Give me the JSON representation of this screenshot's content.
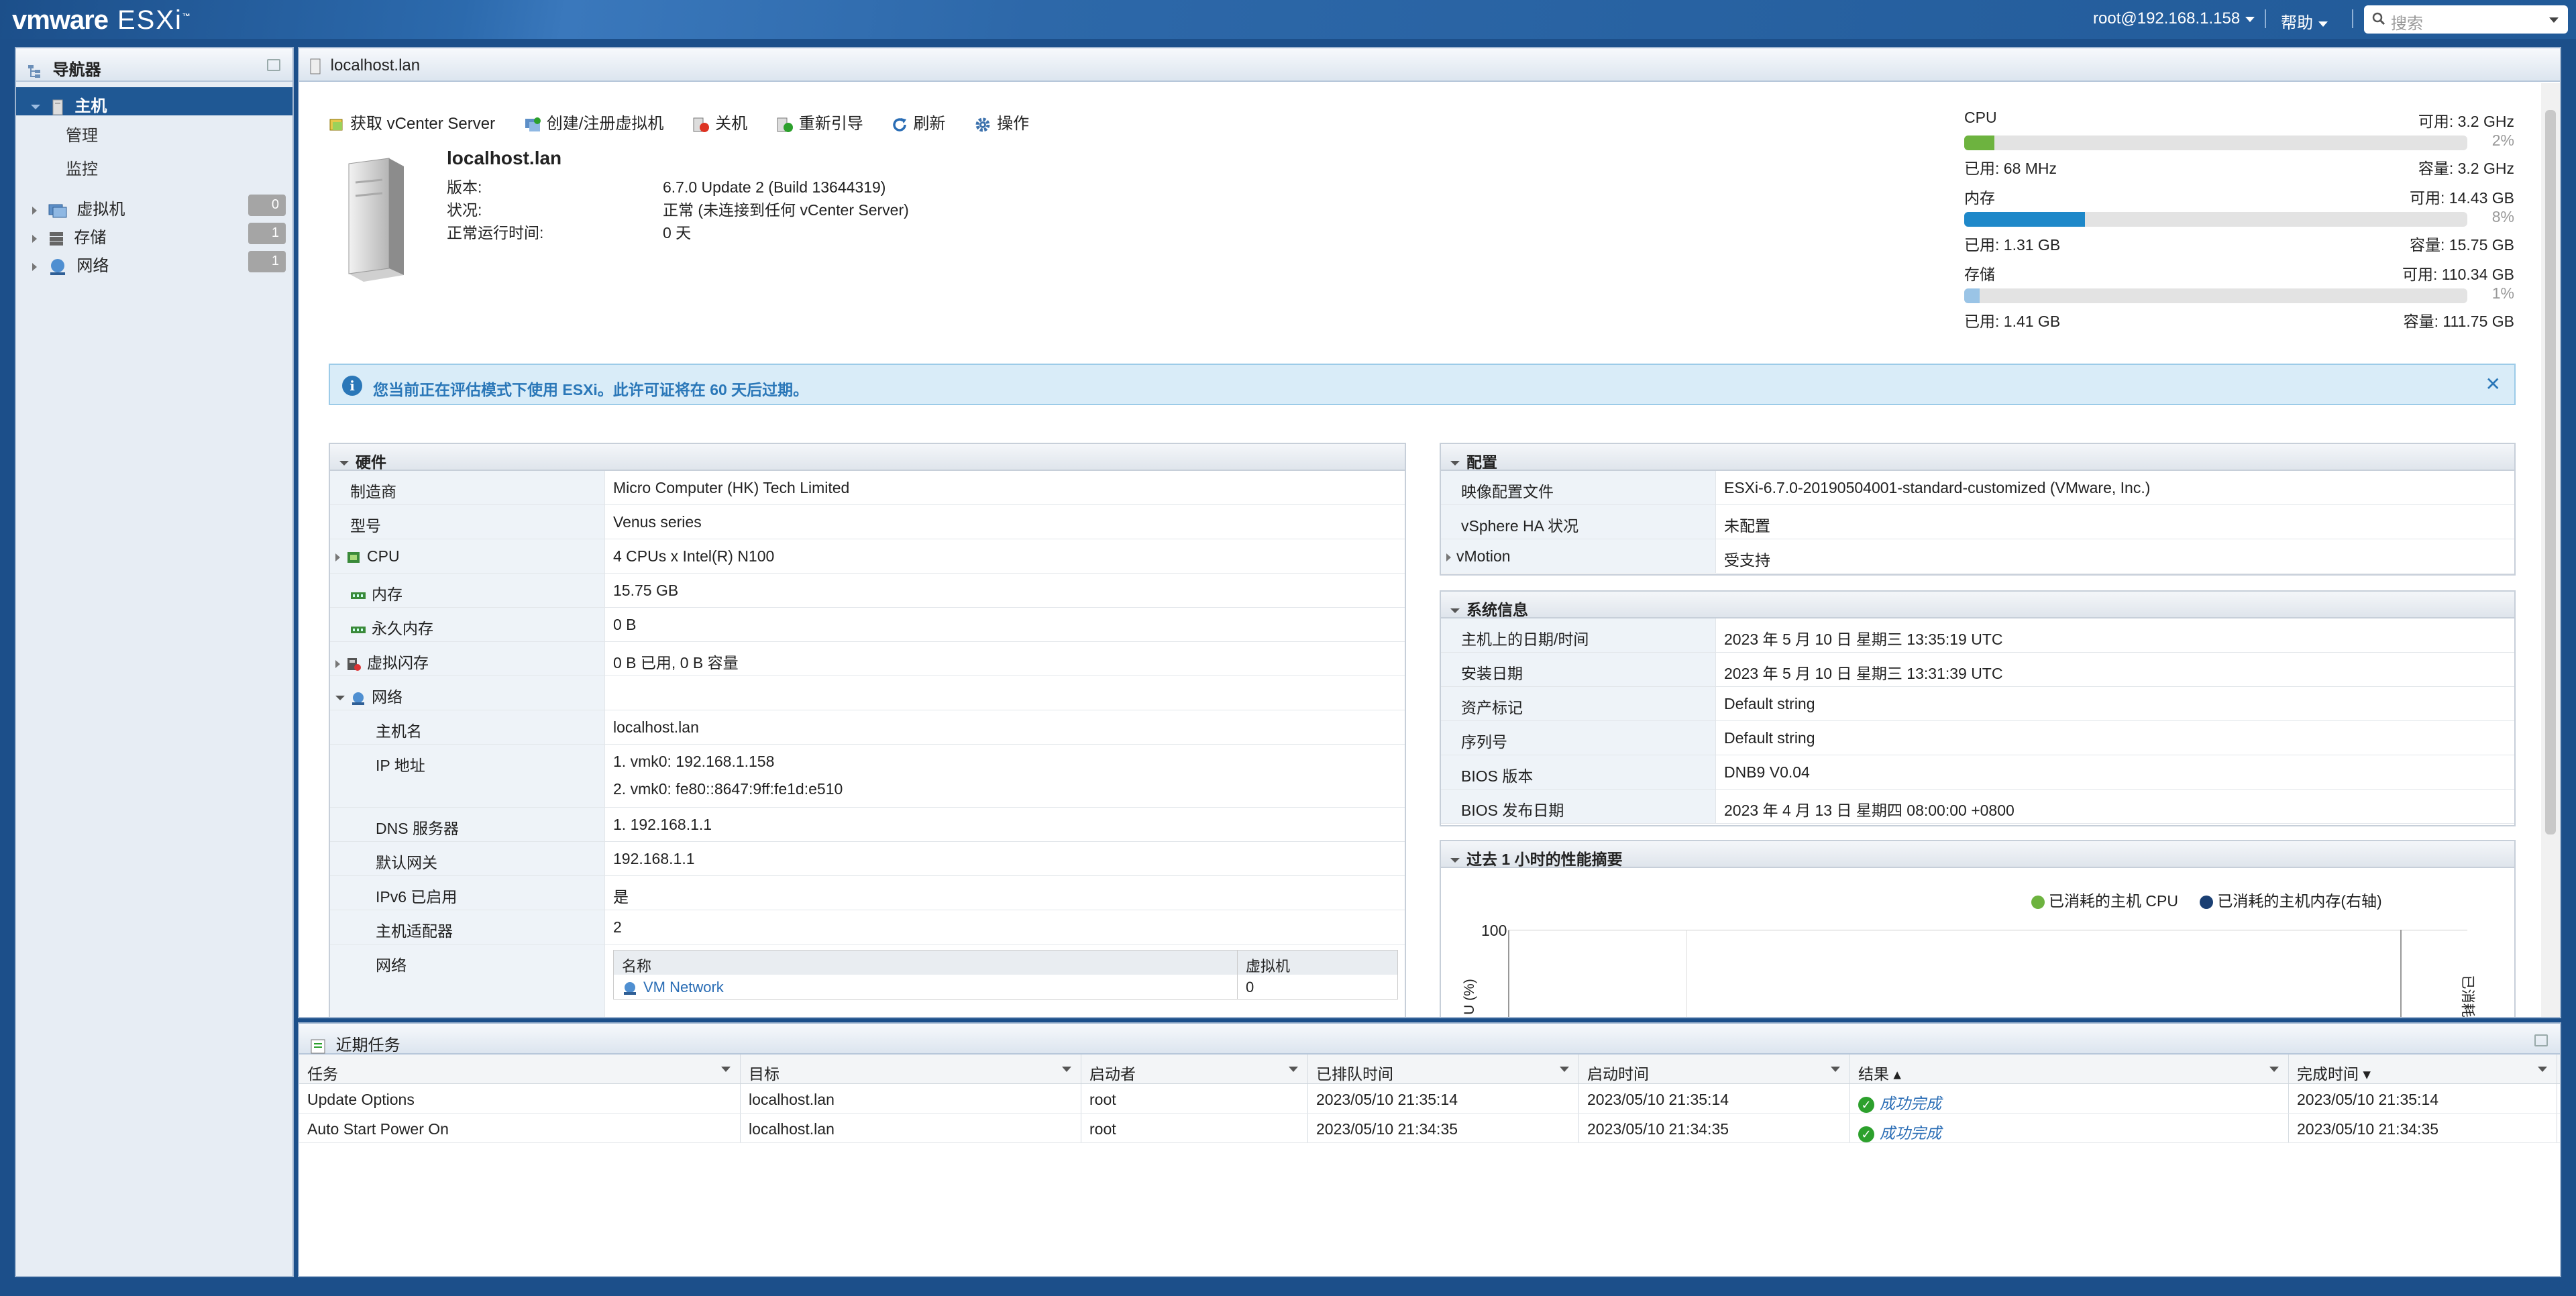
{
  "header": {
    "brand": "vmware",
    "product": "ESXi",
    "user": "root@192.168.1.158",
    "help": "帮助",
    "search_placeholder": "搜索"
  },
  "navigator": {
    "title": "导航器",
    "host_label": "主机",
    "host_sub": [
      "管理",
      "监控"
    ],
    "items": [
      {
        "label": "虚拟机",
        "count": "0"
      },
      {
        "label": "存储",
        "count": "1"
      },
      {
        "label": "网络",
        "count": "1"
      }
    ]
  },
  "main": {
    "title": "localhost.lan",
    "toolbar": [
      "获取 vCenter Server",
      "创建/注册虚拟机",
      "关机",
      "重新引导",
      "刷新",
      "操作"
    ],
    "host": {
      "name": "localhost.lan",
      "rows": [
        {
          "k": "版本:",
          "v": "6.7.0 Update 2 (Build 13644319)"
        },
        {
          "k": "状况:",
          "v": "正常 (未连接到任何 vCenter Server)"
        },
        {
          "k": "正常运行时间:",
          "v": "0 天"
        }
      ]
    },
    "resources": [
      {
        "name": "CPU",
        "free": "可用: 3.2 GHz",
        "pct_label": "2%",
        "pct": 2,
        "used": "已用: 68 MHz",
        "cap": "容量: 3.2 GHz",
        "color": "#6db33f"
      },
      {
        "name": "内存",
        "free": "可用: 14.43 GB",
        "pct_label": "8%",
        "pct": 8,
        "used": "已用: 1.31 GB",
        "cap": "容量: 15.75 GB",
        "color": "#1e88c9"
      },
      {
        "name": "存储",
        "free": "可用: 110.34 GB",
        "pct_label": "1%",
        "pct": 1,
        "used": "已用: 1.41 GB",
        "cap": "容量: 111.75 GB",
        "color": "#9ac4e6"
      }
    ],
    "banner": "您当前正在评估模式下使用 ESXi。此许可证将在 60 天后过期。",
    "hardware": {
      "title": "硬件",
      "rows": [
        {
          "k": "制造商",
          "v": "Micro Computer (HK) Tech Limited"
        },
        {
          "k": "型号",
          "v": "Venus series"
        },
        {
          "k": "CPU",
          "v": "4 CPUs x Intel(R) N100"
        },
        {
          "k": "内存",
          "v": "15.75 GB"
        },
        {
          "k": "永久内存",
          "v": "0 B"
        },
        {
          "k": "虚拟闪存",
          "v": "0 B 已用, 0 B 容量"
        },
        {
          "k": "网络",
          "v": ""
        },
        {
          "k": "主机名",
          "v": "localhost.lan"
        },
        {
          "k": "IP 地址",
          "v": "1. vmk0: 192.168.1.158",
          "v2": "2. vmk0: fe80::8647:9ff:fe1d:e510"
        },
        {
          "k": "DNS 服务器",
          "v": "1. 192.168.1.1"
        },
        {
          "k": "默认网关",
          "v": "192.168.1.1"
        },
        {
          "k": "IPv6 已启用",
          "v": "是"
        },
        {
          "k": "主机适配器",
          "v": "2"
        },
        {
          "k": "网络",
          "v": ""
        }
      ],
      "net_table": {
        "col1": "名称",
        "col2": "虚拟机",
        "row_name": "VM Network",
        "row_vms": "0"
      }
    },
    "config": {
      "title": "配置",
      "rows": [
        {
          "k": "映像配置文件",
          "v": "ESXi-6.7.0-20190504001-standard-customized (VMware, Inc.)"
        },
        {
          "k": "vSphere HA 状况",
          "v": "未配置"
        },
        {
          "k": "vMotion",
          "v": "受支持"
        }
      ]
    },
    "sysinfo": {
      "title": "系统信息",
      "rows": [
        {
          "k": "主机上的日期/时间",
          "v": "2023 年 5 月 10 日 星期三 13:35:19 UTC"
        },
        {
          "k": "安装日期",
          "v": "2023 年 5 月 10 日 星期三 13:31:39 UTC"
        },
        {
          "k": "资产标记",
          "v": "Default string"
        },
        {
          "k": "序列号",
          "v": "Default string"
        },
        {
          "k": "BIOS 版本",
          "v": "DNB9 V0.04"
        },
        {
          "k": "BIOS 发布日期",
          "v": "2023 年 4 月 13 日 星期四 08:00:00 +0800"
        }
      ]
    },
    "perf": {
      "title": "过去 1 小时的性能摘要",
      "legend_cpu": "已消耗的主机 CPU",
      "legend_mem": "已消耗的主机内存(右轴)",
      "ytick": "100",
      "ylabel": "U (%)",
      "ylabel_right": "已消耗",
      "cpu_color": "#6db33f",
      "mem_color": "#1a3f73"
    }
  },
  "tasks": {
    "title": "近期任务",
    "columns": [
      "任务",
      "目标",
      "启动者",
      "已排队时间",
      "启动时间",
      "结果 ▴",
      "完成时间 ▾"
    ],
    "rows": [
      {
        "task": "Update Options",
        "target": "localhost.lan",
        "initiator": "root",
        "queued": "2023/05/10 21:35:14",
        "started": "2023/05/10 21:35:14",
        "result": "成功完成",
        "completed": "2023/05/10 21:35:14"
      },
      {
        "task": "Auto Start Power On",
        "target": "localhost.lan",
        "initiator": "root",
        "queued": "2023/05/10 21:34:35",
        "started": "2023/05/10 21:34:35",
        "result": "成功完成",
        "completed": "2023/05/10 21:34:35"
      }
    ]
  }
}
